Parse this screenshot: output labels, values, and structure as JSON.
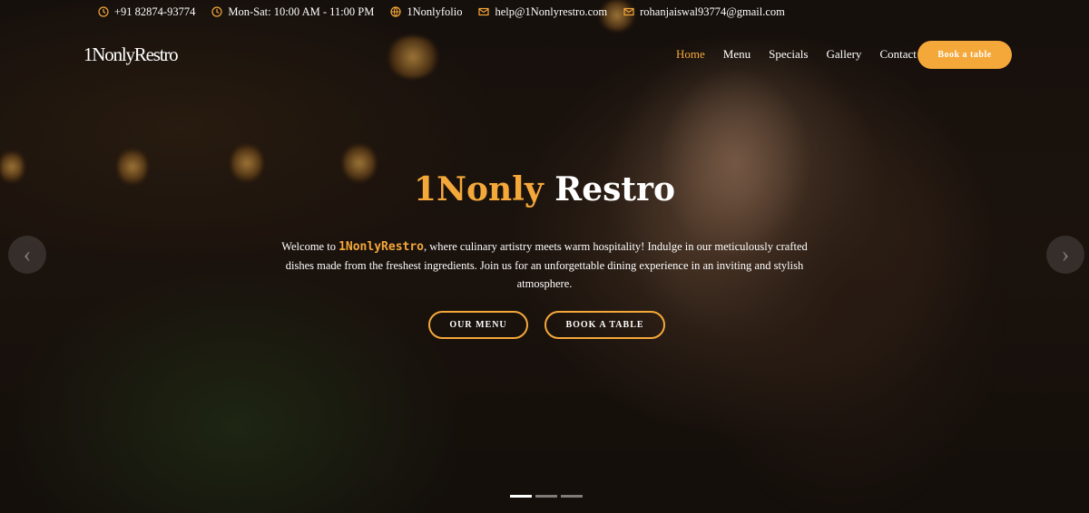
{
  "topbar": {
    "phone": "+91 82874-93774",
    "hours": "Mon-Sat: 10:00 AM - 11:00 PM",
    "portfolio": "1Nonlyfolio",
    "email_restaurant": "help@1Nonlyrestro.com",
    "email_personal": "rohanjaiswal93774@gmail.com"
  },
  "navbar": {
    "logo": "1NonlyRestro",
    "links": [
      "Home",
      "Menu",
      "Specials",
      "Gallery",
      "Contact"
    ],
    "active_link": "Home",
    "book_button": "Book a table"
  },
  "hero": {
    "title_accent": "1Nonly",
    "title_rest": " Restro",
    "desc_prefix": "Welcome to ",
    "desc_brand": "1NonlyRestro",
    "desc_suffix": ", where culinary artistry meets warm hospitality! Indulge in our meticulously crafted dishes made from the freshest ingredients. Join us for an unforgettable dining experience in an inviting and stylish atmosphere.",
    "btn_menu": "OUR MENU",
    "btn_book": "BOOK A TABLE"
  },
  "carousel": {
    "prev_icon": "chevron-left-icon",
    "next_icon": "chevron-right-icon",
    "slides": 3,
    "active_slide": 1
  },
  "colors": {
    "accent": "#f5a83a"
  }
}
